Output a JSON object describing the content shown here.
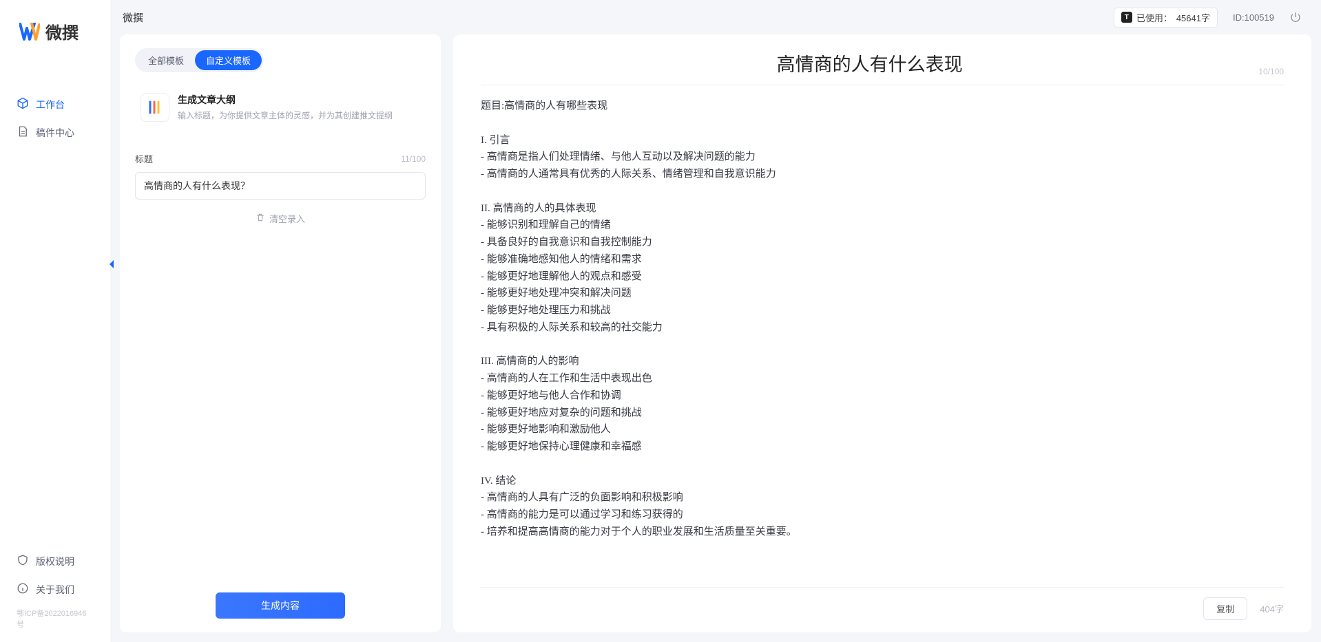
{
  "app": {
    "name": "微撰"
  },
  "logo_text": "微撰",
  "sidebar": {
    "items": [
      {
        "label": "工作台",
        "icon": "cube"
      },
      {
        "label": "稿件中心",
        "icon": "doc"
      }
    ],
    "bottom": [
      {
        "label": "版权说明",
        "icon": "shield"
      },
      {
        "label": "关于我们",
        "icon": "info"
      }
    ],
    "icp": "鄂ICP备2022016946号"
  },
  "topbar": {
    "usage_prefix": "已使用：",
    "usage_value": "45641字",
    "id_label": "ID:",
    "id_value": "100519"
  },
  "left": {
    "tabs": [
      {
        "label": "全部模板"
      },
      {
        "label": "自定义模板"
      }
    ],
    "prompt": {
      "title": "生成文章大纲",
      "desc": "输入标题，为你提供文章主体的灵感，并为其创建推文提纲"
    },
    "title_label": "标题",
    "title_count": "11/100",
    "title_value": "高情商的人有什么表现？",
    "clear_label": "清空录入",
    "generate_label": "生成内容"
  },
  "right": {
    "doc_title": "高情商的人有什么表现",
    "title_count": "10/100",
    "body": "题目:高情商的人有哪些表现\n\nI. 引言\n- 高情商是指人们处理情绪、与他人互动以及解决问题的能力\n- 高情商的人通常具有优秀的人际关系、情绪管理和自我意识能力\n\nII. 高情商的人的具体表现\n- 能够识别和理解自己的情绪\n- 具备良好的自我意识和自我控制能力\n- 能够准确地感知他人的情绪和需求\n- 能够更好地理解他人的观点和感受\n- 能够更好地处理冲突和解决问题\n- 能够更好地处理压力和挑战\n- 具有积极的人际关系和较高的社交能力\n\nIII. 高情商的人的影响\n- 高情商的人在工作和生活中表现出色\n- 能够更好地与他人合作和协调\n- 能够更好地应对复杂的问题和挑战\n- 能够更好地影响和激励他人\n- 能够更好地保持心理健康和幸福感\n\nIV. 结论\n- 高情商的人具有广泛的负面影响和积极影响\n- 高情商的能力是可以通过学习和练习获得的\n- 培养和提高高情商的能力对于个人的职业发展和生活质量至关重要。",
    "copy_label": "复制",
    "char_count": "404字"
  }
}
